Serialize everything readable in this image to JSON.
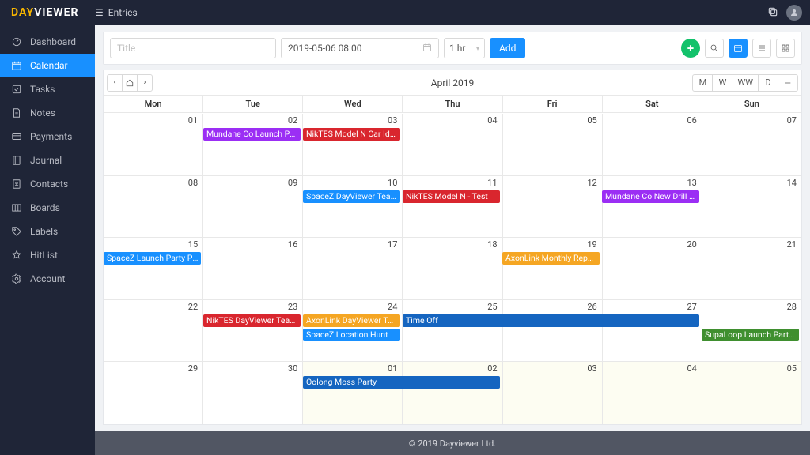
{
  "brand": {
    "part1": "DAY",
    "part2": "VIEWER"
  },
  "topbar": {
    "entries_label": "Entries"
  },
  "sidebar": {
    "items": [
      {
        "key": "dashboard",
        "label": "Dashboard"
      },
      {
        "key": "calendar",
        "label": "Calendar",
        "active": true
      },
      {
        "key": "tasks",
        "label": "Tasks"
      },
      {
        "key": "notes",
        "label": "Notes"
      },
      {
        "key": "payments",
        "label": "Payments"
      },
      {
        "key": "journal",
        "label": "Journal"
      },
      {
        "key": "contacts",
        "label": "Contacts"
      },
      {
        "key": "boards",
        "label": "Boards"
      },
      {
        "key": "labels",
        "label": "Labels"
      },
      {
        "key": "hitlist",
        "label": "HitList"
      },
      {
        "key": "account",
        "label": "Account"
      }
    ]
  },
  "toolbar": {
    "title_placeholder": "Title",
    "date_value": "2019-05-06 08:00",
    "duration_value": "1 hr",
    "add_label": "Add"
  },
  "calendar": {
    "title": "April 2019",
    "view_buttons": [
      "M",
      "W",
      "WW",
      "D"
    ],
    "dow": [
      "Mon",
      "Tue",
      "Wed",
      "Thu",
      "Fri",
      "Sat",
      "Sun"
    ],
    "colors": {
      "purple": "#9b2ef4",
      "red": "#d9262e",
      "blue": "#1890ff",
      "darkblue": "#1565c0",
      "orange": "#f5a623",
      "green": "#3f8f2f"
    },
    "weeks": [
      {
        "days": [
          {
            "n": "01"
          },
          {
            "n": "02"
          },
          {
            "n": "03"
          },
          {
            "n": "04"
          },
          {
            "n": "05"
          },
          {
            "n": "06"
          },
          {
            "n": "07"
          }
        ],
        "events": [
          {
            "label": "Mundane Co Launch Party ...",
            "color": "purple",
            "startCol": 1,
            "span": 1,
            "row": 0
          },
          {
            "label": "NikTES Model N Car Ideas",
            "color": "red",
            "startCol": 2,
            "span": 1,
            "row": 0
          }
        ]
      },
      {
        "days": [
          {
            "n": "08"
          },
          {
            "n": "09"
          },
          {
            "n": "10"
          },
          {
            "n": "11"
          },
          {
            "n": "12"
          },
          {
            "n": "13"
          },
          {
            "n": "14"
          }
        ],
        "events": [
          {
            "label": "SpaceZ DayViewer Team Ro...",
            "color": "blue",
            "startCol": 2,
            "span": 1,
            "row": 0
          },
          {
            "label": "NikTES Model N - Test",
            "color": "red",
            "startCol": 3,
            "span": 1,
            "row": 0
          },
          {
            "label": "Mundane Co New Drill Bit",
            "color": "purple",
            "startCol": 5,
            "span": 1,
            "row": 0
          }
        ]
      },
      {
        "days": [
          {
            "n": "15"
          },
          {
            "n": "16"
          },
          {
            "n": "17"
          },
          {
            "n": "18"
          },
          {
            "n": "19"
          },
          {
            "n": "20"
          },
          {
            "n": "21"
          }
        ],
        "events": [
          {
            "label": "SpaceZ Launch Party Paym...",
            "color": "blue",
            "startCol": 0,
            "span": 1,
            "row": 0
          },
          {
            "label": "AxonLink Monthly Report",
            "color": "orange",
            "startCol": 4,
            "span": 1,
            "row": 0
          }
        ]
      },
      {
        "days": [
          {
            "n": "22"
          },
          {
            "n": "23"
          },
          {
            "n": "24"
          },
          {
            "n": "25"
          },
          {
            "n": "26"
          },
          {
            "n": "27"
          },
          {
            "n": "28"
          }
        ],
        "events": [
          {
            "label": "NikTES DayViewer Team Room",
            "color": "red",
            "startCol": 1,
            "span": 1,
            "row": 0
          },
          {
            "label": "AxonLink DayViewer Team ...",
            "color": "orange",
            "startCol": 2,
            "span": 1,
            "row": 0
          },
          {
            "label": "SpaceZ Location Hunt",
            "color": "blue",
            "startCol": 2,
            "span": 1,
            "row": 1
          },
          {
            "label": "Time Off",
            "color": "darkblue",
            "startCol": 3,
            "span": 3,
            "row": 0
          },
          {
            "label": "SupaLoop Launch Party Pa...",
            "color": "green",
            "startCol": 6,
            "span": 1,
            "row": 1
          }
        ]
      },
      {
        "days": [
          {
            "n": "29"
          },
          {
            "n": "30"
          },
          {
            "n": "01",
            "other": true
          },
          {
            "n": "02",
            "other": true
          },
          {
            "n": "03",
            "other": true
          },
          {
            "n": "04",
            "other": true
          },
          {
            "n": "05",
            "other": true
          }
        ],
        "events": [
          {
            "label": "Oolong Moss Party",
            "color": "darkblue",
            "startCol": 2,
            "span": 2,
            "row": 0
          }
        ]
      }
    ]
  },
  "footer": {
    "text": "© 2019 Dayviewer Ltd."
  }
}
